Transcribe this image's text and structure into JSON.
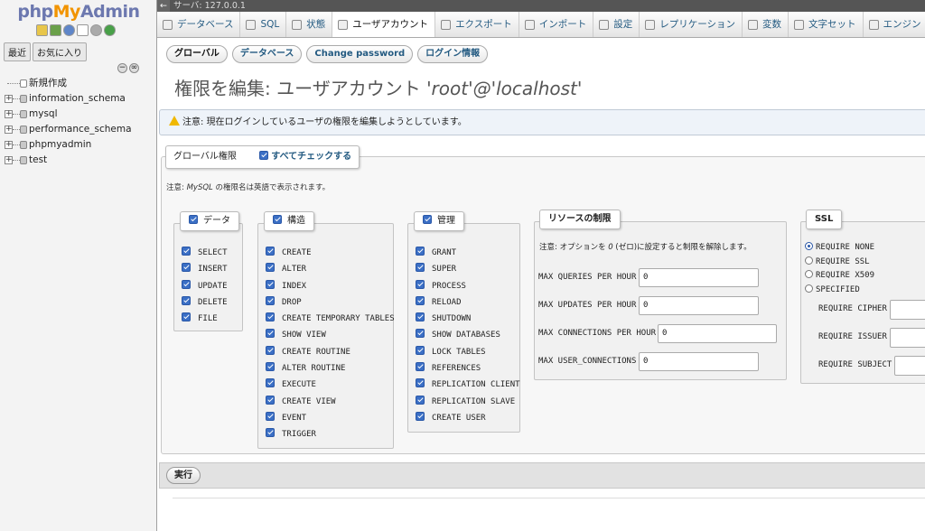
{
  "sidebar": {
    "logo": {
      "p1": "php",
      "p2": "My",
      "p3": "Admin"
    },
    "tabs": [
      "最近",
      "お気に入り"
    ],
    "tree": [
      {
        "label": "新規作成",
        "type": "new"
      },
      {
        "label": "information_schema",
        "type": "db"
      },
      {
        "label": "mysql",
        "type": "db"
      },
      {
        "label": "performance_schema",
        "type": "db"
      },
      {
        "label": "phpmyadmin",
        "type": "db"
      },
      {
        "label": "test",
        "type": "db"
      }
    ]
  },
  "server_bar": {
    "label": "サーバ: 127.0.0.1"
  },
  "main_tabs": [
    {
      "label": "データベース",
      "icon": "database-icon"
    },
    {
      "label": "SQL",
      "icon": "sql-icon"
    },
    {
      "label": "状態",
      "icon": "status-icon"
    },
    {
      "label": "ユーザアカウント",
      "icon": "users-icon",
      "active": true
    },
    {
      "label": "エクスポート",
      "icon": "export-icon"
    },
    {
      "label": "インポート",
      "icon": "import-icon"
    },
    {
      "label": "設定",
      "icon": "wrench-icon"
    },
    {
      "label": "レプリケーション",
      "icon": "replication-icon"
    },
    {
      "label": "変数",
      "icon": "variables-icon"
    },
    {
      "label": "文字セット",
      "icon": "charset-icon"
    },
    {
      "label": "エンジン",
      "icon": "engine-icon"
    }
  ],
  "sub_tabs": [
    "グローバル",
    "データベース",
    "Change password",
    "ログイン情報"
  ],
  "title": {
    "prefix": "権限を編集: ユーザアカウント ",
    "account": "'root'@'localhost'"
  },
  "notice": "注意: 現在ログインしているユーザの権限を編集しようとしています。",
  "global": {
    "legend": "グローバル権限",
    "check_all": "すべてチェックする",
    "note_prefix": "注意: ",
    "note_italic": "MySQL",
    "note_suffix": " の権限名は英語で表示されます。"
  },
  "data_group": {
    "legend": "データ",
    "items": [
      "SELECT",
      "INSERT",
      "UPDATE",
      "DELETE",
      "FILE"
    ]
  },
  "structure_group": {
    "legend": "構造",
    "items": [
      "CREATE",
      "ALTER",
      "INDEX",
      "DROP",
      "CREATE TEMPORARY TABLES",
      "SHOW VIEW",
      "CREATE ROUTINE",
      "ALTER ROUTINE",
      "EXECUTE",
      "CREATE VIEW",
      "EVENT",
      "TRIGGER"
    ]
  },
  "admin_group": {
    "legend": "管理",
    "items": [
      "GRANT",
      "SUPER",
      "PROCESS",
      "RELOAD",
      "SHUTDOWN",
      "SHOW DATABASES",
      "LOCK TABLES",
      "REFERENCES",
      "REPLICATION CLIENT",
      "REPLICATION SLAVE",
      "CREATE USER"
    ]
  },
  "resources": {
    "legend": "リソースの制限",
    "note_prefix": "注意: オプションを ",
    "note_italic": "0",
    "note_suffix": " (ゼロ)に設定すると制限を解除します。",
    "rows": [
      {
        "label": "MAX QUERIES PER HOUR",
        "value": "0"
      },
      {
        "label": "MAX UPDATES PER HOUR",
        "value": "0"
      },
      {
        "label": "MAX CONNECTIONS PER HOUR",
        "value": "0"
      },
      {
        "label": "MAX USER_CONNECTIONS",
        "value": "0"
      }
    ]
  },
  "ssl": {
    "legend": "SSL",
    "options": [
      "REQUIRE NONE",
      "REQUIRE SSL",
      "REQUIRE X509",
      "SPECIFIED"
    ],
    "selected": "REQUIRE NONE",
    "fields": [
      "REQUIRE CIPHER",
      "REQUIRE ISSUER",
      "REQUIRE SUBJECT"
    ]
  },
  "footer": {
    "go": "実行"
  }
}
